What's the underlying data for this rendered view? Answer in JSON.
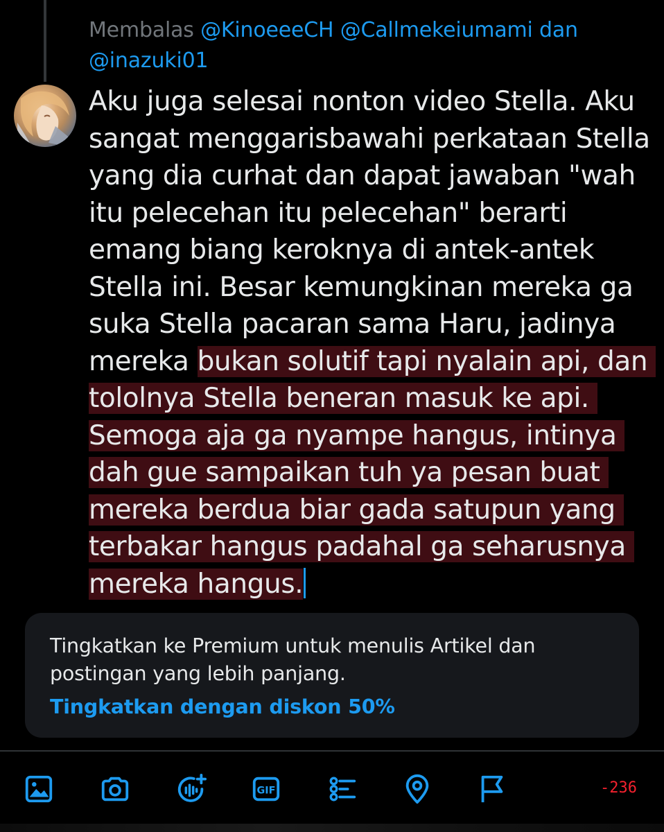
{
  "reply": {
    "prefix": "Membalas",
    "mention1": "@KinoeeeCH",
    "mention2": "@Callmekeiumami",
    "conjunction": "dan",
    "mention3": "@inazuki01"
  },
  "composer": {
    "normal_text": "Aku juga selesai nonton video Stella. Aku sangat menggarisbawahi perkataan Stella yang dia curhat dan dapat jawaban \"wah itu pelecehan itu pelecehan\" berarti emang biang keroknya di antek-antek Stella ini. Besar kemungkinan mereka ga suka Stella pacaran sama Haru, jadinya mereka ",
    "overflow_text": "bukan solutif tapi nyalain api, dan tololnya Stella beneran masuk ke api. Semoga aja ga nyampe hangus, intinya dah gue sampaikan tuh ya pesan buat mereka berdua biar gada satupun yang terbakar hangus padahal ga seharusnya mereka hangus."
  },
  "premium": {
    "message": "Tingkatkan ke Premium untuk menulis Artikel dan postingan yang lebih panjang.",
    "cta": "Tingkatkan dengan diskon 50%"
  },
  "toolbar": {
    "icons": [
      "image-icon",
      "camera-icon",
      "grok-voice-icon",
      "gif-icon",
      "poll-icon",
      "location-icon",
      "flag-icon"
    ],
    "gif_label": "GIF"
  },
  "char_counter": "-236",
  "colors": {
    "accent": "#1d9bf0",
    "overflow_highlight": "#3f0d13",
    "counter_red": "#f4212e"
  }
}
